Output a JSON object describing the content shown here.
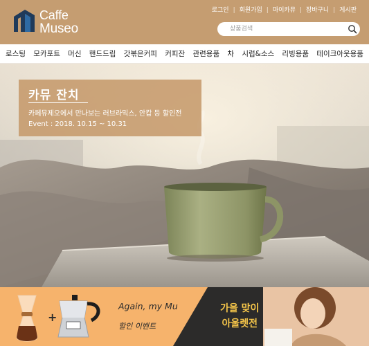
{
  "header": {
    "logo_line1": "Caffe",
    "logo_line2": "Museo",
    "util_links": [
      "로그인",
      "회원가입",
      "마이카뮤",
      "장바구니",
      "게시판"
    ],
    "search_placeholder": "상품검색",
    "colors": {
      "brand": "#c59d71",
      "logo_mark": "#1f3a5a"
    }
  },
  "category_nav": {
    "items": [
      "로스팅",
      "모카포트",
      "머신",
      "핸드드립",
      "갓볶은커피",
      "커피잔",
      "관련용품",
      "차",
      "시럽&소스",
      "리빙용품",
      "테이크아웃용품"
    ]
  },
  "hero": {
    "title": "카뮤 잔치",
    "subtitle": "카페뮤제오에서 만나보는 러브라믹스, 안캅 등 할인전",
    "date": "Event : 2018. 10.15 ~ 10.31"
  },
  "banners": {
    "promo": {
      "title": "Again, my Mu",
      "subtitle": "할인 이벤트",
      "plus": "+"
    },
    "outlet": {
      "line1": "가을 맞이",
      "line2": "아울렛전"
    }
  },
  "icons": [
    "logo-icon",
    "search-icon"
  ]
}
